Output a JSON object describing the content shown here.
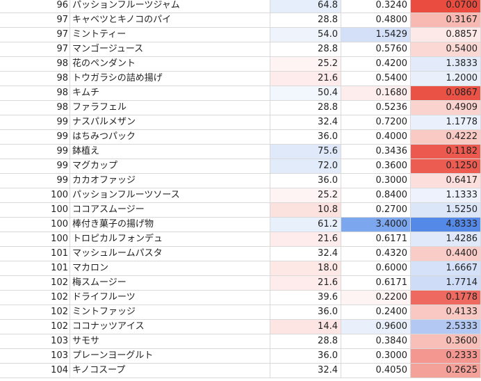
{
  "sheet": {
    "rows": [
      {
        "id": "96",
        "name": "パッションフルーツジャム",
        "v1": "64.8",
        "v2": "0.3240",
        "v3": "0.0700",
        "bg1": "#e6eefb",
        "bg2": "#ffffff",
        "bg3": "#ea4d40"
      },
      {
        "id": "97",
        "name": "キャベツとキノコのパイ",
        "v1": "28.8",
        "v2": "0.4800",
        "v3": "0.3167",
        "bg1": "#ffffff",
        "bg2": "#ffffff",
        "bg3": "#f7b9b2"
      },
      {
        "id": "97",
        "name": "ミントティー",
        "v1": "54.0",
        "v2": "1.5429",
        "v3": "0.8857",
        "bg1": "#eef3fc",
        "bg2": "#d3e0f8",
        "bg3": "#fde9e7"
      },
      {
        "id": "97",
        "name": "マンゴージュース",
        "v1": "28.8",
        "v2": "0.5760",
        "v3": "0.5400",
        "bg1": "#ffffff",
        "bg2": "#ffffff",
        "bg3": "#fbd8d4"
      },
      {
        "id": "98",
        "name": "花のペンダント",
        "v1": "25.2",
        "v2": "0.4200",
        "v3": "1.3833",
        "bg1": "#fef4f3",
        "bg2": "#ffffff",
        "bg3": "#e3ebfa"
      },
      {
        "id": "98",
        "name": "トウガラシの詰め揚げ",
        "v1": "21.6",
        "v2": "0.5400",
        "v3": "1.2000",
        "bg1": "#fdeceb",
        "bg2": "#ffffff",
        "bg3": "#eaf0fb"
      },
      {
        "id": "98",
        "name": "キムチ",
        "v1": "50.4",
        "v2": "0.1680",
        "v3": "0.0867",
        "bg1": "#f2f6fd",
        "bg2": "#fdeeed",
        "bg3": "#eb5246"
      },
      {
        "id": "98",
        "name": "ファラフェル",
        "v1": "28.8",
        "v2": "0.5236",
        "v3": "0.4909",
        "bg1": "#ffffff",
        "bg2": "#ffffff",
        "bg3": "#fad3cf"
      },
      {
        "id": "99",
        "name": "ナスパルメザン",
        "v1": "32.4",
        "v2": "0.7200",
        "v3": "1.1778",
        "bg1": "#ffffff",
        "bg2": "#ffffff",
        "bg3": "#ebf1fc"
      },
      {
        "id": "99",
        "name": "はちみつパック",
        "v1": "36.0",
        "v2": "0.4000",
        "v3": "0.4222",
        "bg1": "#ffffff",
        "bg2": "#ffffff",
        "bg3": "#f9c9c4"
      },
      {
        "id": "99",
        "name": "鉢植え",
        "v1": "75.6",
        "v2": "0.3436",
        "v3": "0.1182",
        "bg1": "#dfe9fa",
        "bg2": "#ffffff",
        "bg3": "#ec5a4f"
      },
      {
        "id": "99",
        "name": "マグカップ",
        "v1": "72.0",
        "v2": "0.3600",
        "v3": "0.1250",
        "bg1": "#e2ebfa",
        "bg2": "#ffffff",
        "bg3": "#ec5c51"
      },
      {
        "id": "99",
        "name": "カカオファッジ",
        "v1": "36.0",
        "v2": "0.3000",
        "v3": "0.6417",
        "bg1": "#ffffff",
        "bg2": "#ffffff",
        "bg3": "#fcdfdc"
      },
      {
        "id": "100",
        "name": "パッションフルーツソース",
        "v1": "25.2",
        "v2": "0.8400",
        "v3": "1.1333",
        "bg1": "#fef4f3",
        "bg2": "#ffffff",
        "bg3": "#edf2fc"
      },
      {
        "id": "100",
        "name": "ココアスムージー",
        "v1": "10.8",
        "v2": "0.2700",
        "v3": "1.5250",
        "bg1": "#fce2df",
        "bg2": "#ffffff",
        "bg3": "#dbe6f9"
      },
      {
        "id": "100",
        "name": "棒付き菓子の揚げ物",
        "v1": "61.2",
        "v2": "3.4000",
        "v3": "4.8333",
        "bg1": "#e8f0fb",
        "bg2": "#7ca6ee",
        "bg3": "#5489e8"
      },
      {
        "id": "100",
        "name": "トロピカルフォンデュ",
        "v1": "21.6",
        "v2": "0.6171",
        "v3": "1.4286",
        "bg1": "#fdeceb",
        "bg2": "#ffffff",
        "bg3": "#e0e9fa"
      },
      {
        "id": "101",
        "name": "マッシュルームパスタ",
        "v1": "32.4",
        "v2": "0.4320",
        "v3": "0.4400",
        "bg1": "#ffffff",
        "bg2": "#ffffff",
        "bg3": "#f9ccc7"
      },
      {
        "id": "101",
        "name": "マカロン",
        "v1": "18.0",
        "v2": "0.6000",
        "v3": "1.6667",
        "bg1": "#fde8e6",
        "bg2": "#ffffff",
        "bg3": "#d4e1f8"
      },
      {
        "id": "102",
        "name": "梅スムージー",
        "v1": "21.6",
        "v2": "0.6171",
        "v3": "1.7714",
        "bg1": "#fdeceb",
        "bg2": "#ffffff",
        "bg3": "#cedcf7"
      },
      {
        "id": "102",
        "name": "ドライフルーツ",
        "v1": "39.6",
        "v2": "0.2200",
        "v3": "0.1778",
        "bg1": "#ffffff",
        "bg2": "#fef4f3",
        "bg3": "#ee6a60"
      },
      {
        "id": "102",
        "name": "ミントファッジ",
        "v1": "36.0",
        "v2": "0.2400",
        "v3": "0.4133",
        "bg1": "#ffffff",
        "bg2": "#ffffff",
        "bg3": "#f9c8c3"
      },
      {
        "id": "102",
        "name": "ココナッツアイス",
        "v1": "14.4",
        "v2": "0.9600",
        "v3": "2.5333",
        "bg1": "#fce5e3",
        "bg2": "#eaf0fb",
        "bg3": "#b3c9f3"
      },
      {
        "id": "103",
        "name": "サモサ",
        "v1": "28.8",
        "v2": "0.3840",
        "v3": "0.3600",
        "bg1": "#ffffff",
        "bg2": "#ffffff",
        "bg3": "#f8beb8"
      },
      {
        "id": "103",
        "name": "プレーンヨーグルト",
        "v1": "36.0",
        "v2": "0.3000",
        "v3": "0.2333",
        "bg1": "#ffffff",
        "bg2": "#ffffff",
        "bg3": "#f49790"
      },
      {
        "id": "104",
        "name": "キノコスープ",
        "v1": "32.4",
        "v2": "0.4050",
        "v3": "0.2625",
        "bg1": "#ffffff",
        "bg2": "#ffffff",
        "bg3": "#f4a19a"
      }
    ]
  }
}
